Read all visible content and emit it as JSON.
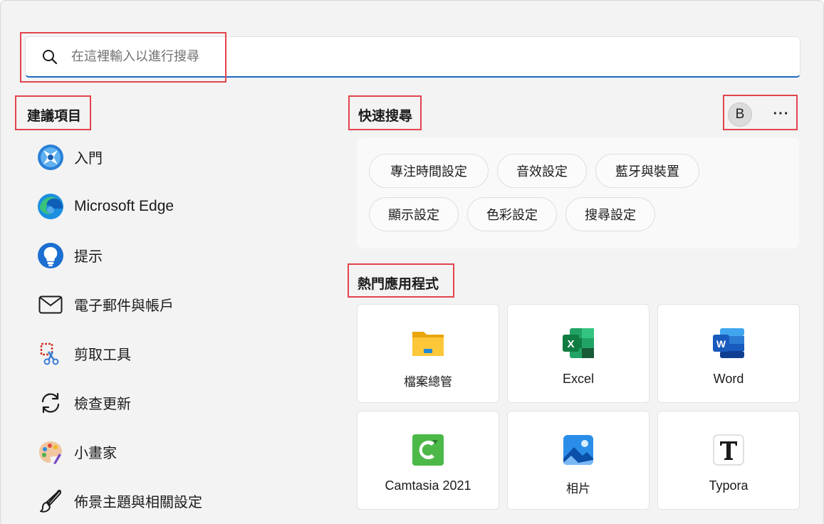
{
  "search": {
    "placeholder": "在這裡輸入以進行搜尋",
    "icon": "search-icon"
  },
  "suggestions": {
    "title": "建議項目",
    "items": [
      {
        "label": "入門",
        "icon": "get-started-icon"
      },
      {
        "label": "Microsoft Edge",
        "icon": "edge-icon"
      },
      {
        "label": "提示",
        "icon": "tips-bulb-icon"
      },
      {
        "label": "電子郵件與帳戶",
        "icon": "mail-icon"
      },
      {
        "label": "剪取工具",
        "icon": "snipping-tool-icon"
      },
      {
        "label": "檢查更新",
        "icon": "refresh-icon"
      },
      {
        "label": "小畫家",
        "icon": "paint-palette-icon"
      },
      {
        "label": "佈景主題與相關設定",
        "icon": "brush-icon"
      }
    ]
  },
  "quick_search": {
    "title": "快速搜尋",
    "avatar_letter": "B",
    "more_label": "···",
    "chips_row1": [
      "專注時間設定",
      "音效設定",
      "藍牙與裝置"
    ],
    "chips_row2": [
      "顯示設定",
      "色彩設定",
      "搜尋設定"
    ]
  },
  "top_apps": {
    "title": "熱門應用程式",
    "apps": [
      {
        "label": "檔案總管",
        "icon": "file-explorer-icon"
      },
      {
        "label": "Excel",
        "icon": "excel-icon"
      },
      {
        "label": "Word",
        "icon": "word-icon"
      },
      {
        "label": "Camtasia 2021",
        "icon": "camtasia-icon"
      },
      {
        "label": "相片",
        "icon": "photos-icon"
      },
      {
        "label": "Typora",
        "icon": "typora-icon"
      }
    ]
  },
  "colors": {
    "accent": "#1e68c2",
    "highlight_box": "#e2444c",
    "panel_background": "#f3f3f3"
  }
}
